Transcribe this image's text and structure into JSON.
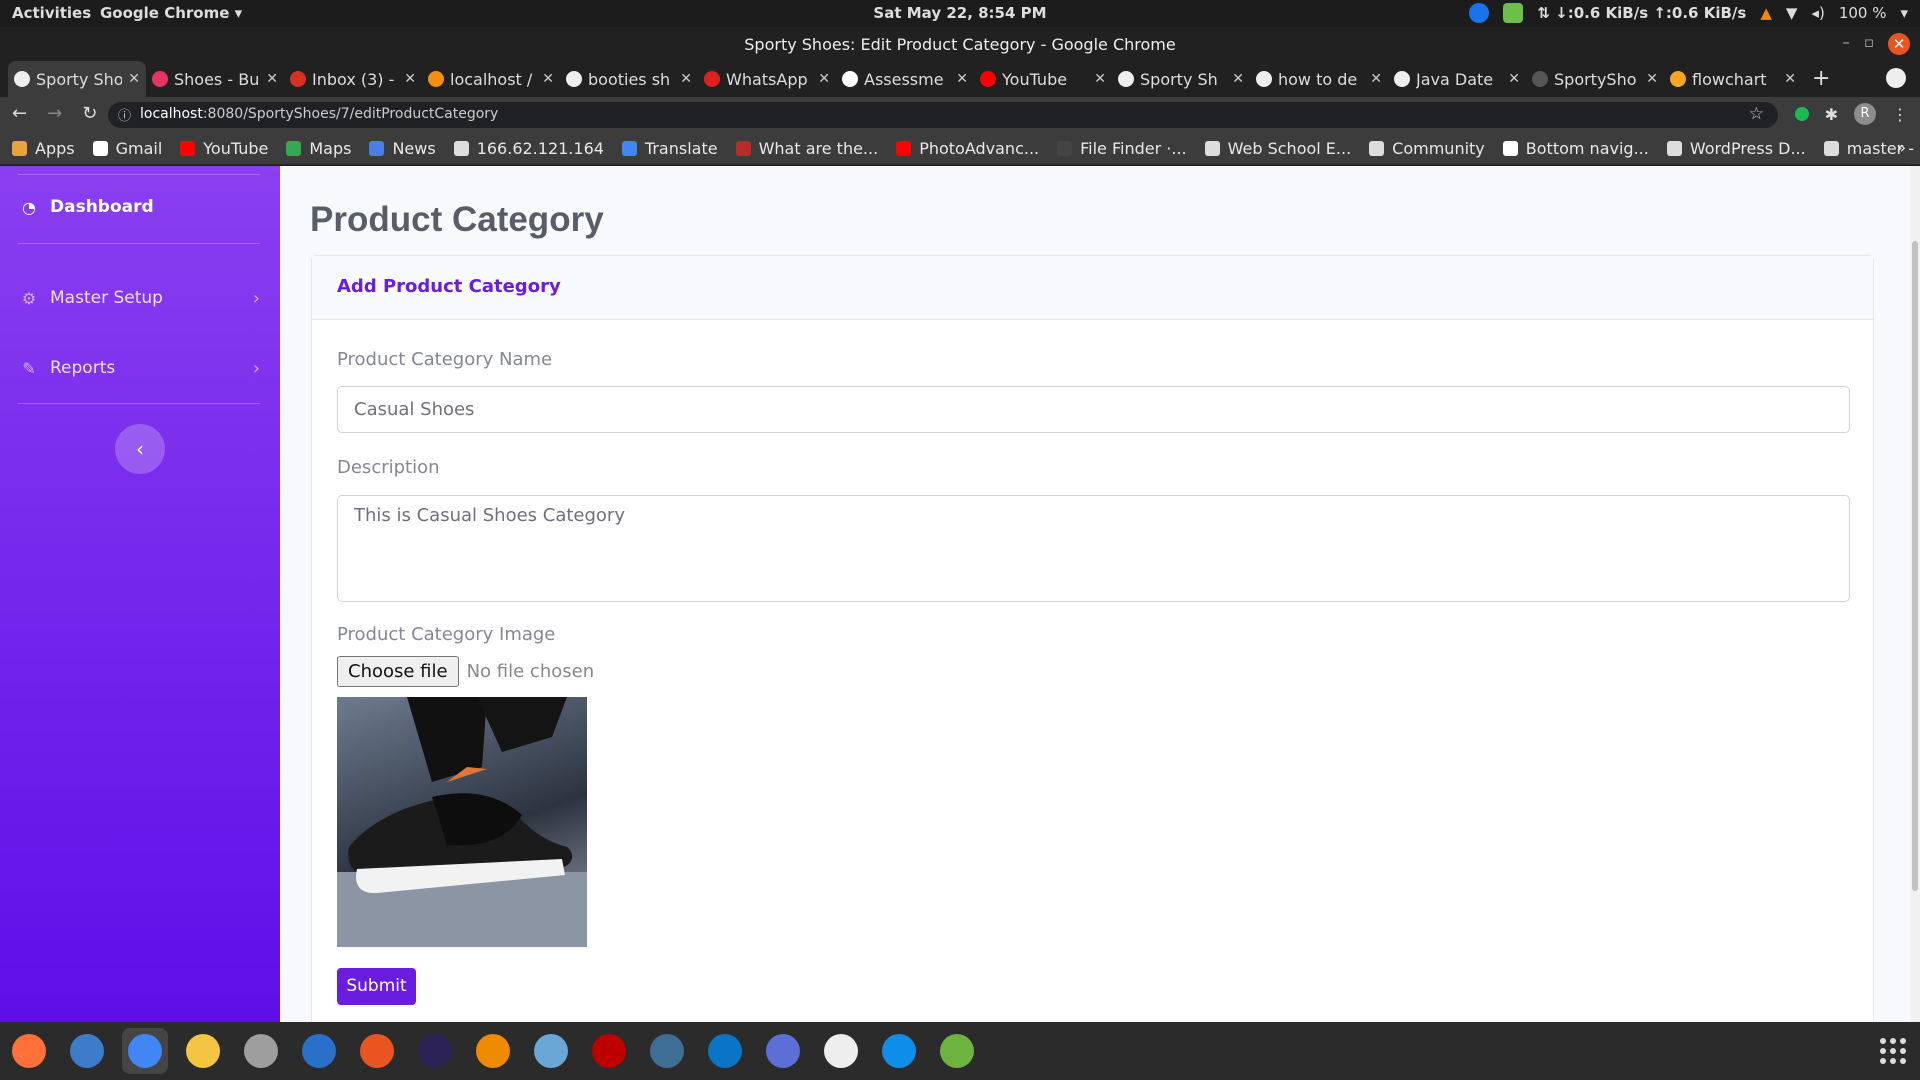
{
  "topbar": {
    "activities": "Activities",
    "app": "Google Chrome ▾",
    "clock": "Sat May 22,  8:54 PM",
    "net": "⇅ ↓:0.6 KiB/s ↑:0.6 KiB/s",
    "battery": "100 %"
  },
  "window": {
    "title": "Sporty Shoes: Edit Product Category - Google Chrome"
  },
  "tabs": [
    {
      "label": "Sporty Shoes",
      "color": "#eeeeee"
    },
    {
      "label": "Shoes - Buy",
      "color": "#e5365f"
    },
    {
      "label": "Inbox (3) -",
      "color": "#d93025"
    },
    {
      "label": "localhost /",
      "color": "#f29111"
    },
    {
      "label": "booties sh",
      "color": "#eeeeee"
    },
    {
      "label": "WhatsApp",
      "color": "#e02020"
    },
    {
      "label": "Assessme",
      "color": "#ffffff"
    },
    {
      "label": "YouTube",
      "color": "#ff0000"
    },
    {
      "label": "Sporty Sh",
      "color": "#eeeeee"
    },
    {
      "label": "how to de",
      "color": "#eeeeee"
    },
    {
      "label": "Java Date",
      "color": "#eeeeee"
    },
    {
      "label": "SportySho",
      "color": "#555555"
    },
    {
      "label": "flowchart",
      "color": "#f5a623"
    }
  ],
  "address": {
    "host": "localhost",
    "path": ":8080/SportyShoes/7/editProductCategory",
    "avatar": "R"
  },
  "bookmarks": [
    {
      "label": "Apps",
      "color": "#e8a33d"
    },
    {
      "label": "Gmail",
      "color": "#ffffff"
    },
    {
      "label": "YouTube",
      "color": "#ff0000"
    },
    {
      "label": "Maps",
      "color": "#34a853"
    },
    {
      "label": "News",
      "color": "#4c7ee8"
    },
    {
      "label": "166.62.121.164",
      "color": "#dddddd"
    },
    {
      "label": "Translate",
      "color": "#4285f4"
    },
    {
      "label": "What are the...",
      "color": "#b92b27"
    },
    {
      "label": "PhotoAdvanc...",
      "color": "#ff0000"
    },
    {
      "label": "File Finder ·...",
      "color": "#444444"
    },
    {
      "label": "Web School E...",
      "color": "#dddddd"
    },
    {
      "label": "Community",
      "color": "#dddddd"
    },
    {
      "label": "Bottom navig...",
      "color": "#ffffff"
    },
    {
      "label": "WordPress D...",
      "color": "#dddddd"
    },
    {
      "label": "master - platf...",
      "color": "#dddddd"
    }
  ],
  "sidebar": {
    "dashboard": "Dashboard",
    "master_setup": "Master Setup",
    "reports": "Reports",
    "toggle": "‹"
  },
  "main": {
    "page_title": "Product Category",
    "card_header": "Add Product Category",
    "name_label": "Product Category Name",
    "name_value": "Casual Shoes",
    "desc_label": "Description",
    "desc_value": "This is Casual Shoes Category",
    "image_label": "Product Category Image",
    "file_button": "Choose file",
    "file_status": "No file chosen",
    "submit": "Submit"
  },
  "dock": [
    {
      "name": "firefox",
      "color": "#ff7139"
    },
    {
      "name": "thunderbird",
      "color": "#3d7cc9"
    },
    {
      "name": "chrome",
      "color": "#4285f4"
    },
    {
      "name": "rhythmbox",
      "color": "#f4c542"
    },
    {
      "name": "files",
      "color": "#9e9e9e"
    },
    {
      "name": "writer",
      "color": "#2a6fc9"
    },
    {
      "name": "software",
      "color": "#e95420"
    },
    {
      "name": "eclipse",
      "color": "#2c2255"
    },
    {
      "name": "vlc",
      "color": "#f08a00"
    },
    {
      "name": "virtualbox",
      "color": "#6aa6d6"
    },
    {
      "name": "filezilla",
      "color": "#bf0000"
    },
    {
      "name": "mysql-workbench",
      "color": "#3e6e93"
    },
    {
      "name": "vscode",
      "color": "#0a74c7"
    },
    {
      "name": "screenshot",
      "color": "#5d6fd6"
    },
    {
      "name": "text-editor",
      "color": "#eeeeee"
    },
    {
      "name": "teamviewer",
      "color": "#0e8ee9"
    },
    {
      "name": "spring-tool-suite",
      "color": "#6db33f"
    }
  ]
}
